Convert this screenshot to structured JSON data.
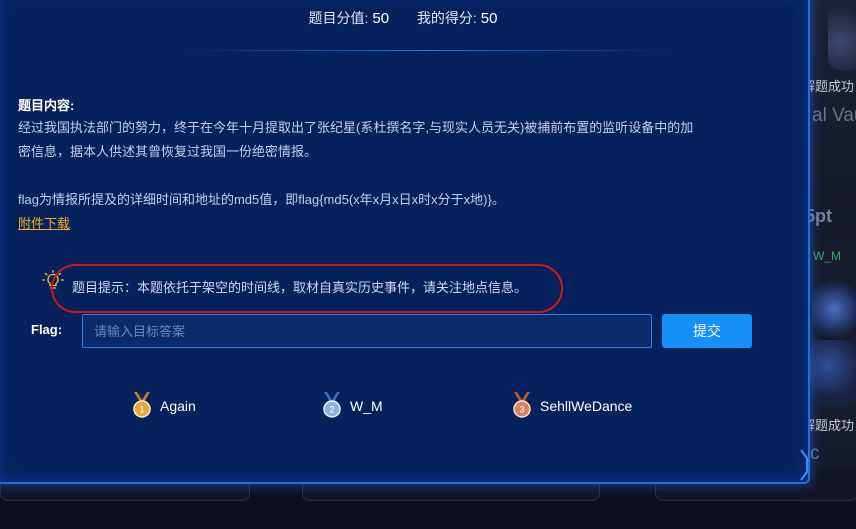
{
  "scoreboard": {
    "problem_score_label": "题目分值:",
    "problem_score_value": "50",
    "my_score_label": "我的得分:",
    "my_score_value": "50"
  },
  "content": {
    "heading": "题目内容:",
    "paragraph_line1": "经过我国执法部门的努力，终于在今年十月提取出了张纪星(系杜撰名字,与现实人员无关)被捕前布置的监听设备中的加",
    "paragraph_line2": "密信息，据本人供述其曾恢复过我国一份绝密情报。",
    "flag_format": "flag为情报所提及的详细时间和地址的md5值，即flag{md5(x年x月x日x时x分于x地)}。",
    "download_link": "附件下载"
  },
  "hint": {
    "text": "题目提示：本题依托于架空的时间线，取材自真实历史事件，请关注地点信息。"
  },
  "flag_form": {
    "label": "Flag:",
    "placeholder": "请输入目标答案",
    "value": "",
    "submit_label": "提交"
  },
  "solvers": [
    {
      "rank": "1",
      "name": "Again",
      "medal": "gold-medal-icon",
      "color": "#e5a53a"
    },
    {
      "rank": "2",
      "name": "W_M",
      "medal": "silver-medal-icon",
      "color": "#8fb2dc"
    },
    {
      "rank": "3",
      "name": "SehllWeDance",
      "medal": "bronze-medal-icon",
      "color": "#d9835a"
    }
  ],
  "background": {
    "text1": "解题成功",
    "text2": "al Vau",
    "text3": "5pt",
    "text4": "W_M",
    "text5": "解题成功",
    "text6": "c"
  },
  "colors": {
    "modal_bg": "#07215c",
    "accent": "#1690f8",
    "link": "#f5b21b",
    "highlight": "#d01818"
  }
}
